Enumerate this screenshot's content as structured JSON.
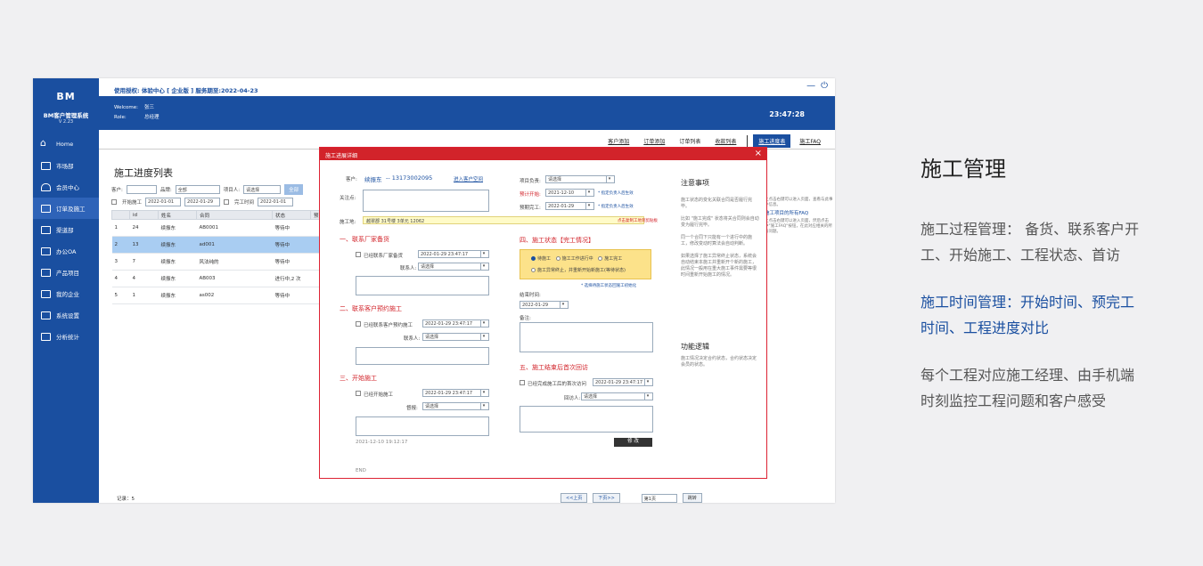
{
  "panel": {
    "title": "施工管理",
    "para1": "施工过程管理： 备货、联系客户开工、开始施工、工程状态、首访",
    "para2": "施工时间管理：开始时间、预完工时间、工程进度对比",
    "para3": "每个工程对应施工经理、由手机端时刻监控工程问题和客户感受"
  },
  "app": {
    "logo": "BM",
    "name": "BM客户管理系统",
    "version": "V 2.23",
    "license": "使用授权: 体验中心 [ 企业版 ]  服务期至:2022-04-23",
    "welcome_label": "Welcome:",
    "welcome_user": "张三",
    "role_label": "Role:",
    "role_value": "总经理",
    "clock": "23:47:28",
    "nav": [
      {
        "label": "Home"
      },
      {
        "label": "市场部"
      },
      {
        "label": "会员中心"
      },
      {
        "label": "订单及施工"
      },
      {
        "label": "渠道部"
      },
      {
        "label": "办公OA"
      },
      {
        "label": "产品项目"
      },
      {
        "label": "我的企业"
      },
      {
        "label": "系统设置"
      },
      {
        "label": "分析统计"
      }
    ],
    "tabs": [
      {
        "label": "客户添加"
      },
      {
        "label": "订单添加"
      },
      {
        "label": "订单列表"
      },
      {
        "label": "收款列表"
      },
      {
        "label": "施工进度表"
      },
      {
        "label": "施工FAQ"
      }
    ]
  },
  "list": {
    "title": "施工进度列表",
    "customer_label": "客户:",
    "brand_label": "品牌:",
    "brand_value": "全部",
    "manager_label": "项目人:",
    "manager_value": "请选择",
    "all_btn": "全部",
    "start_label": "开始施工",
    "date_a": "2022-01-01",
    "date_b": "2022-01-29",
    "finish_label": "完工时间",
    "date_c": "2022-01-01",
    "columns": [
      "",
      "id",
      "姓名",
      "合同",
      "状态",
      "预"
    ],
    "rows": [
      {
        "n": "1",
        "id": "24",
        "name": "续振东",
        "contract": "AB0001",
        "status": "等待中"
      },
      {
        "n": "2",
        "id": "13",
        "name": "续振东",
        "contract": "ad001",
        "status": "等待中"
      },
      {
        "n": "3",
        "id": "7",
        "name": "续振东",
        "contract": "风法纯的",
        "status": "等待中"
      },
      {
        "n": "4",
        "id": "4",
        "name": "续振东",
        "contract": "AB003",
        "status": "进行中,2 次"
      },
      {
        "n": "5",
        "id": "1",
        "name": "续振东",
        "contract": "as002",
        "status": "等待中"
      }
    ],
    "record": "记录：5",
    "prev": "<<上页",
    "next": "下页>>",
    "page": "第1页",
    "jump": "跳转",
    "notes": {
      "a": "上点击右键可以进入页面，查看与此事件信息。",
      "h": "施工项目的所有FAQ",
      "b": "上点击右键可以进入页面，然后点击中\"施工FAQ\"按钮，在此对应相关的所有问题。"
    }
  },
  "modal": {
    "title": "施工进展详细",
    "customer_label": "客户:",
    "customer_name": "续振东",
    "phone": "-- 13173002095",
    "enter_link": "进入客户空间",
    "attention_label": "关注点:",
    "address_label": "施工地:",
    "address": "越翠郡 31号楼 3单元 12062",
    "address_link": "点击复制工地到剪贴板",
    "s1": "一、联系厂家备货",
    "s1_check": "已经联系厂家备货",
    "s1_date": "2022-01-29 23:47:17",
    "contact_label": "联系人:",
    "select": "请选择",
    "s2": "二、联系客户预约施工",
    "s2_check": "已经联系客户预约施工",
    "s2_date": "2022-01-29 23:47:17",
    "s3": "三、开始施工",
    "s3_check": "已经开始施工",
    "s3_date": "2022-01-29 23:47:17",
    "crew_label": "督报:",
    "timestamp": "2021-12-10 19:12:17",
    "end": "END",
    "pm_label": "项目负责:",
    "plan_start_label": "预计开始:",
    "plan_start": "2021-12-10",
    "plan_note": "* 指定负责人后生效",
    "plan_end_label": "预期完工:",
    "plan_end": "2022-01-29",
    "s4": "四、施工状态【完工情况】",
    "st_wait": "待施工",
    "st_doing": "施工工作进行中",
    "st_done": "施工完工",
    "st_abnormal": "施工异常终止，并重新开始新施工(等待状态)",
    "st_link": "* 选择待施工状态回施工初始化",
    "end_time_label": "结束时间:",
    "end_time": "2022-01-29",
    "remark_label": "备注:",
    "s5": "五、施工结束后首次回访",
    "s5_check": "已经完成施工后的首次访问",
    "s5_date": "2022-01-29 23:47:17",
    "visitor_label": "回访人:",
    "save": "修 改",
    "notes_h": "注意事项",
    "notes_p1": "施工状态的变化关联合同是否履行完毕。",
    "notes_p2": "比如 \"施工完成\" 状态将关合同则会自动变为履行完毕。",
    "notes_p3": "同一个合同下只能有一个进行中的施工，修改变动时算法会自动判断。",
    "notes_p4": "如果选择了施工异常终止状态，系统会自动结束本施工并重新开个新的施工，此情况一般用在重大施工事件需要等很时间重新开始施工的情况。",
    "logic_h": "功能逻辑",
    "logic_p": "施工情况决定合约状态，合约状态决定会员的状态。"
  }
}
